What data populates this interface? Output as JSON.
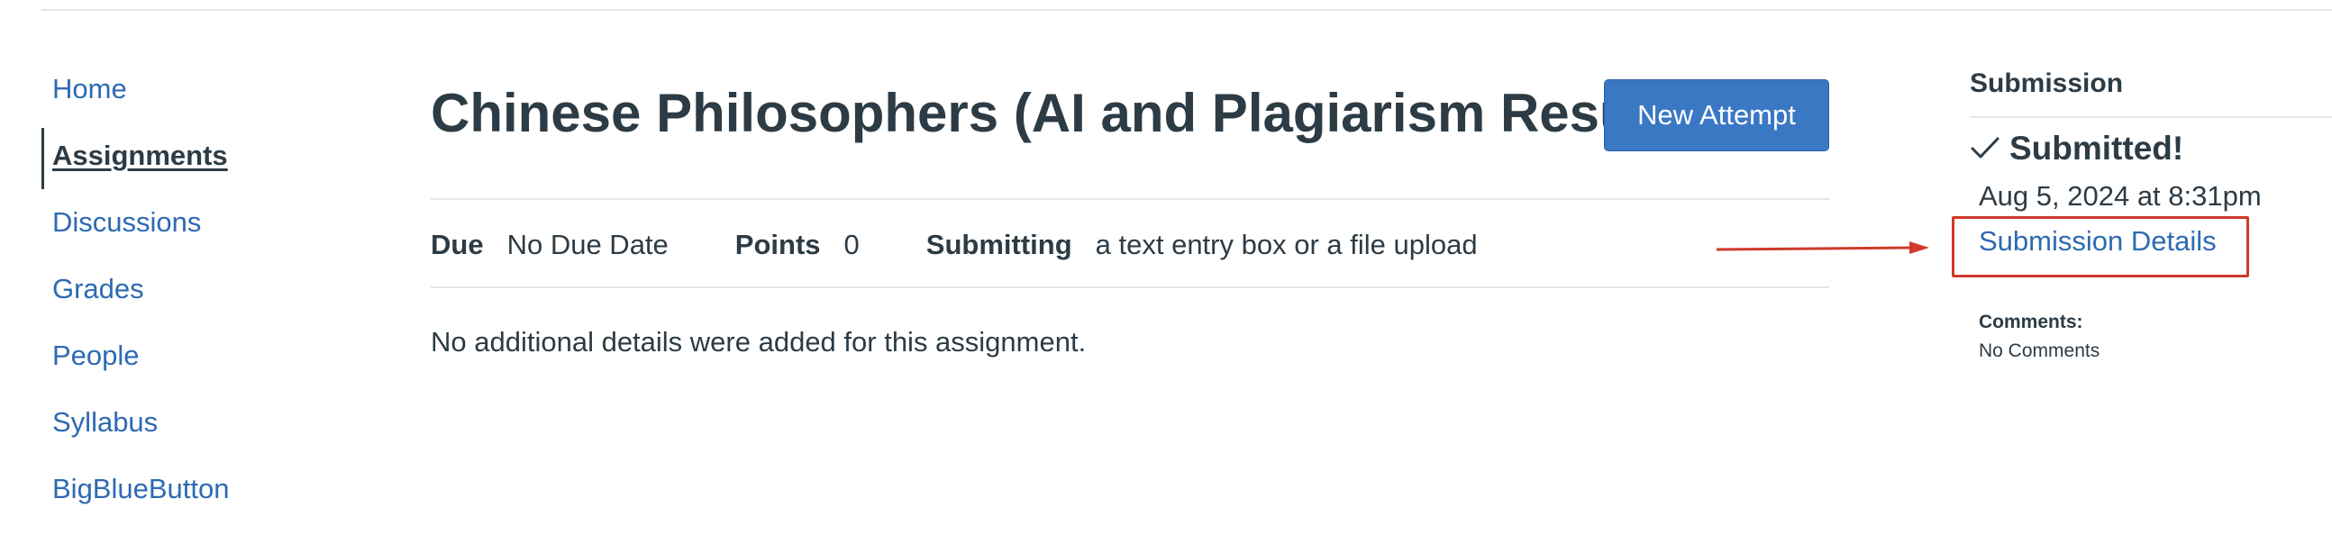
{
  "nav": {
    "items": [
      {
        "label": "Home",
        "active": false
      },
      {
        "label": "Assignments",
        "active": true
      },
      {
        "label": "Discussions",
        "active": false
      },
      {
        "label": "Grades",
        "active": false
      },
      {
        "label": "People",
        "active": false
      },
      {
        "label": "Syllabus",
        "active": false
      },
      {
        "label": "BigBlueButton",
        "active": false
      }
    ]
  },
  "assignment": {
    "title": "Chinese Philosophers (AI and Plagiarism Results)",
    "new_attempt_label": "New Attempt",
    "due_label": "Due",
    "due_value": "No Due Date",
    "points_label": "Points",
    "points_value": "0",
    "submitting_label": "Submitting",
    "submitting_value": "a text entry box or a file upload",
    "description": "No additional details were added for this assignment."
  },
  "submission": {
    "heading": "Submission",
    "status": "Submitted!",
    "status_icon": "check-icon",
    "date": "Aug 5, 2024 at 8:31pm",
    "details_link": "Submission Details",
    "comments_label": "Comments:",
    "comments_value": "No Comments"
  },
  "colors": {
    "link": "#2d6ab2",
    "text": "#2d3b45",
    "button": "#3b78c4",
    "annotation": "#d03a2b",
    "divider": "#e4e6e8"
  }
}
